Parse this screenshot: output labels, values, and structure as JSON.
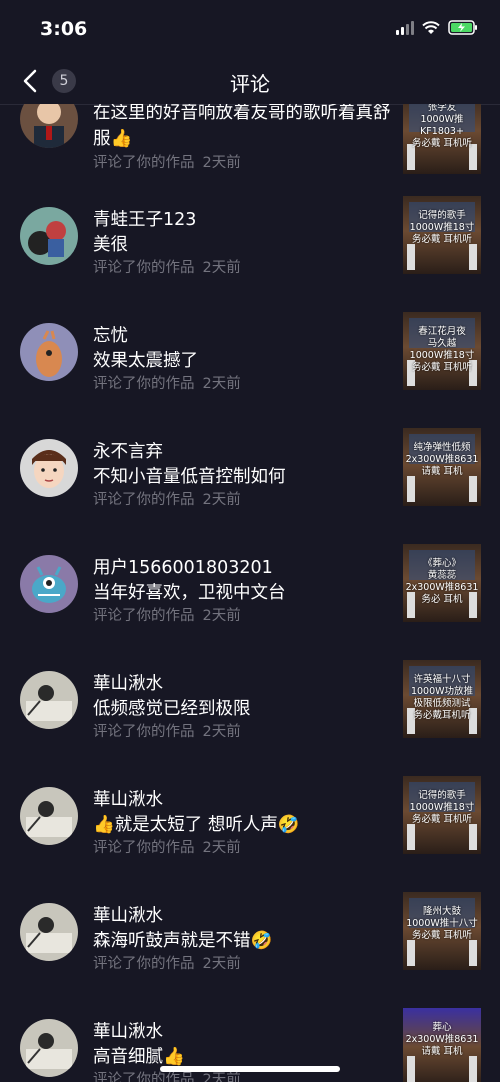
{
  "status_bar": {
    "time": "3:06"
  },
  "header": {
    "title": "评论",
    "back_count": "5"
  },
  "items": [
    {
      "user": "",
      "comment": "在这里的好音响放着友哥的歌听着真舒服👍",
      "action": "评论了你的作品",
      "time": "2天前",
      "thumb": "张学友\n1000W推KF1803+\n务必戴 耳机听"
    },
    {
      "user": "青蛙王子123",
      "comment": "美很",
      "action": "评论了你的作品",
      "time": "2天前",
      "thumb": "记得的歌手\n1000W推18寸\n务必戴 耳机听"
    },
    {
      "user": "忘忧",
      "comment": "效果太震撼了",
      "action": "评论了你的作品",
      "time": "2天前",
      "thumb": "春江花月夜\n马久越\n1000W推18寸\n务必戴 耳机听"
    },
    {
      "user": "永不言弃",
      "comment": "不知小音量低音控制如何",
      "action": "评论了你的作品",
      "time": "2天前",
      "thumb": "纯净弹性低频\n2x300W推8631\n请戴 耳机"
    },
    {
      "user": "用户1566001803201",
      "comment": "当年好喜欢，卫视中文台",
      "action": "评论了你的作品",
      "time": "2天前",
      "thumb": "《葬心》\n黄蕊蕊\n2x300W推8631\n务必 耳机"
    },
    {
      "user": "華山湫水",
      "comment": "低频感觉已经到极限",
      "action": "评论了你的作品",
      "time": "2天前",
      "thumb": "许英福十八寸\n1000W功放推\n极限低频测试\n务必戴耳机听"
    },
    {
      "user": "華山湫水",
      "comment": "👍就是太短了 想听人声🤣",
      "action": "评论了你的作品",
      "time": "2天前",
      "thumb": "记得的歌手\n1000W推18寸\n务必戴 耳机听"
    },
    {
      "user": "華山湫水",
      "comment": "森海听鼓声就是不错🤣",
      "action": "评论了你的作品",
      "time": "2天前",
      "thumb": "隆州大鼓\n1000W推十八寸\n务必戴 耳机听"
    },
    {
      "user": "華山湫水",
      "comment": "高音细腻👍",
      "action": "评论了你的作品",
      "time": "2天前",
      "thumb": "葬心\n2x300W推8631\n请戴 耳机"
    }
  ]
}
